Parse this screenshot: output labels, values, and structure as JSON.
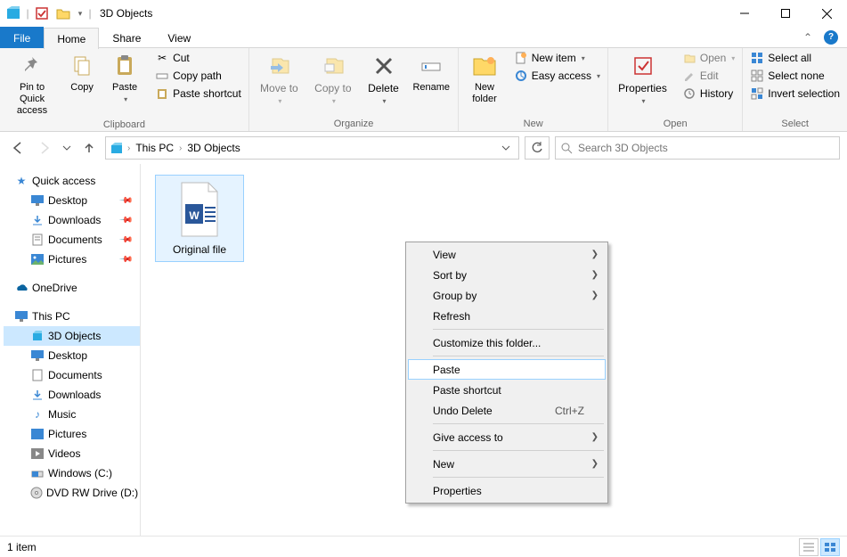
{
  "title": "3D Objects",
  "tabs": {
    "file": "File",
    "home": "Home",
    "share": "Share",
    "view": "View"
  },
  "ribbon": {
    "clipboard": {
      "label": "Clipboard",
      "pin": "Pin to Quick access",
      "copy": "Copy",
      "paste": "Paste",
      "cut": "Cut",
      "copypath": "Copy path",
      "pasteshort": "Paste shortcut"
    },
    "organize": {
      "label": "Organize",
      "moveto": "Move to",
      "copyto": "Copy to",
      "delete": "Delete",
      "rename": "Rename"
    },
    "new": {
      "label": "New",
      "newfolder": "New folder",
      "newitem": "New item",
      "easyaccess": "Easy access"
    },
    "open": {
      "label": "Open",
      "properties": "Properties",
      "open": "Open",
      "edit": "Edit",
      "history": "History"
    },
    "select": {
      "label": "Select",
      "selectall": "Select all",
      "selectnone": "Select none",
      "invert": "Invert selection"
    }
  },
  "breadcrumbs": [
    "This PC",
    "3D Objects"
  ],
  "search_placeholder": "Search 3D Objects",
  "nav": {
    "quickaccess": "Quick access",
    "desktop": "Desktop",
    "downloads": "Downloads",
    "documents": "Documents",
    "pictures": "Pictures",
    "onedrive": "OneDrive",
    "thispc": "This PC",
    "objects3d": "3D Objects",
    "desktop2": "Desktop",
    "documents2": "Documents",
    "downloads2": "Downloads",
    "music": "Music",
    "pictures2": "Pictures",
    "videos": "Videos",
    "cdrive": "Windows  (C:)",
    "dvd": "DVD RW Drive (D:)"
  },
  "file_name": "Original file",
  "ctx": {
    "view": "View",
    "sortby": "Sort by",
    "groupby": "Group by",
    "refresh": "Refresh",
    "customize": "Customize this folder...",
    "paste": "Paste",
    "pastesc": "Paste shortcut",
    "undo": "Undo Delete",
    "undo_sc": "Ctrl+Z",
    "giveaccess": "Give access to",
    "new": "New",
    "properties": "Properties"
  },
  "status_text": "1 item"
}
